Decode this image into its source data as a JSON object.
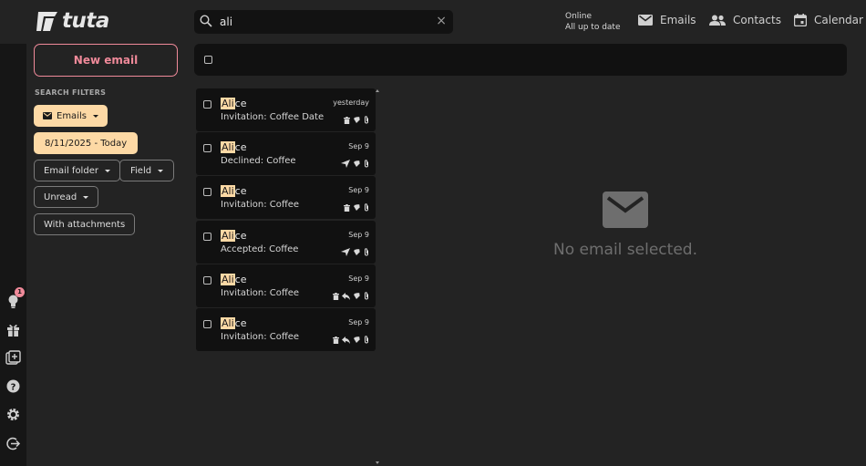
{
  "app": {
    "logo_text": "tuta"
  },
  "search": {
    "value": "ali",
    "placeholder": ""
  },
  "status": {
    "line1": "Online",
    "line2": "All up to date"
  },
  "nav": {
    "emails": "Emails",
    "contacts": "Contacts",
    "calendar": "Calendar"
  },
  "new_email_label": "New email",
  "filters": {
    "title": "SEARCH FILTERS",
    "emails": "Emails",
    "date_range": "8/11/2025 - Today",
    "email_folder": "Email folder",
    "field": "Field",
    "unread": "Unread",
    "attachments": "With attachments"
  },
  "rail": {
    "notification_count": "1"
  },
  "mails": [
    {
      "sender_hl": "Ali",
      "sender_rest": "ce",
      "subject": "Invitation: Coffee Date",
      "date": "yesterday",
      "icons": [
        "trash-icon",
        "calendar-lock-icon",
        "attachment-icon"
      ]
    },
    {
      "sender_hl": "Ali",
      "sender_rest": "ce",
      "subject": "Declined: Coffee",
      "date": "Sep 9",
      "icons": [
        "sent-icon",
        "calendar-lock-icon",
        "attachment-icon"
      ]
    },
    {
      "sender_hl": "Ali",
      "sender_rest": "ce",
      "subject": "Invitation: Coffee",
      "date": "Sep 9",
      "icons": [
        "trash-icon",
        "calendar-lock-icon",
        "attachment-icon"
      ]
    },
    {
      "sender_hl": "Ali",
      "sender_rest": "ce",
      "subject": "Accepted: Coffee",
      "date": "Sep 9",
      "icons": [
        "sent-icon",
        "calendar-lock-icon",
        "attachment-icon"
      ]
    },
    {
      "sender_hl": "Ali",
      "sender_rest": "ce",
      "subject": "Invitation: Coffee",
      "date": "Sep 9",
      "icons": [
        "trash-icon",
        "reply-icon",
        "calendar-lock-icon",
        "attachment-icon"
      ]
    },
    {
      "sender_hl": "Ali",
      "sender_rest": "ce",
      "subject": "Invitation: Coffee",
      "date": "Sep 9",
      "icons": [
        "trash-icon",
        "reply-icon",
        "calendar-lock-icon",
        "attachment-icon"
      ]
    }
  ],
  "empty_state": {
    "label": "No email selected."
  },
  "colors": {
    "accent": "#f08a9a",
    "highlight": "#fdd9a5",
    "background": "#232323",
    "panel": "#111111"
  }
}
